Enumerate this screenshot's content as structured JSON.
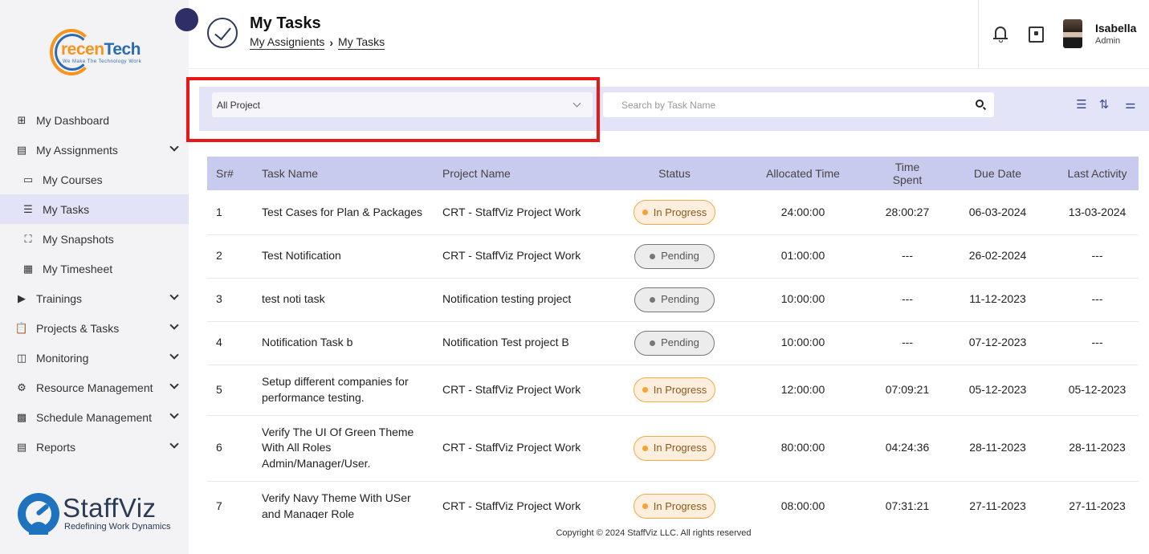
{
  "brand": {
    "name_part1": "recen",
    "name_part2": "Tech",
    "tagline": "We Make The Technology Work"
  },
  "sidebar": {
    "items": [
      {
        "label": "My Dashboard",
        "icon": "dashboard-icon"
      },
      {
        "label": "My Assignments",
        "icon": "assignments-icon"
      },
      {
        "label": "My Courses",
        "icon": "courses-icon"
      },
      {
        "label": "My Tasks",
        "icon": "tasks-icon"
      },
      {
        "label": "My Snapshots",
        "icon": "snapshots-icon"
      },
      {
        "label": "My Timesheet",
        "icon": "timesheet-icon"
      },
      {
        "label": "Trainings",
        "icon": "trainings-icon"
      },
      {
        "label": "Projects & Tasks",
        "icon": "projects-icon"
      },
      {
        "label": "Monitoring",
        "icon": "monitoring-icon"
      },
      {
        "label": "Resource Management",
        "icon": "resource-icon"
      },
      {
        "label": "Schedule Management",
        "icon": "schedule-icon"
      },
      {
        "label": "Reports",
        "icon": "reports-icon"
      }
    ]
  },
  "footer_brand": {
    "name": "StaffViz",
    "tagline": "Redefining Work Dynamics"
  },
  "header": {
    "title": "My Tasks",
    "breadcrumb": [
      "My Assignients",
      "My Tasks"
    ]
  },
  "user": {
    "name": "Isabella",
    "role": "Admin"
  },
  "filters": {
    "project_select": "All Project",
    "search_placeholder": "Search by Task Name"
  },
  "table": {
    "columns": [
      "Sr#",
      "Task Name",
      "Project Name",
      "Status",
      "Allocated Time",
      "Time Spent",
      "Due Date",
      "Last Activity"
    ],
    "rows": [
      {
        "sr": "1",
        "task": "Test Cases for Plan & Packages",
        "project": "CRT - StaffViz Project Work",
        "status": "In Progress",
        "allocated": "24:00:00",
        "spent": "28:00:27",
        "due": "06-03-2024",
        "last": "13-03-2024"
      },
      {
        "sr": "2",
        "task": "Test Notification",
        "project": "CRT - StaffViz Project Work",
        "status": "Pending",
        "allocated": "01:00:00",
        "spent": "---",
        "due": "26-02-2024",
        "last": "---"
      },
      {
        "sr": "3",
        "task": "test noti task",
        "project": "Notification testing project",
        "status": "Pending",
        "allocated": "10:00:00",
        "spent": "---",
        "due": "11-12-2023",
        "last": "---"
      },
      {
        "sr": "4",
        "task": "Notification Task b",
        "project": "Notification Test project B",
        "status": "Pending",
        "allocated": "10:00:00",
        "spent": "---",
        "due": "07-12-2023",
        "last": "---"
      },
      {
        "sr": "5",
        "task": "Setup different companies for performance testing.",
        "project": "CRT - StaffViz Project Work",
        "status": "In Progress",
        "allocated": "12:00:00",
        "spent": "07:09:21",
        "due": "05-12-2023",
        "last": "05-12-2023"
      },
      {
        "sr": "6",
        "task": "Verify The UI Of Green Theme With All Roles Admin/Manager/User.",
        "project": "CRT - StaffViz Project Work",
        "status": "In Progress",
        "allocated": "80:00:00",
        "spent": "04:24:36",
        "due": "28-11-2023",
        "last": "28-11-2023"
      },
      {
        "sr": "7",
        "task": "Verify Navy Theme With USer and Manager Role",
        "project": "CRT - StaffViz Project Work",
        "status": "In Progress",
        "allocated": "08:00:00",
        "spent": "07:31:21",
        "due": "27-11-2023",
        "last": "27-11-2023"
      }
    ]
  },
  "footer": {
    "copyright": "Copyright © 2024 StaffViz LLC. All rights reserved"
  },
  "colors": {
    "accent": "#2e2f66",
    "in_progress": "#f3ab47",
    "pending": "#777777",
    "highlight": "#e81818",
    "header_row": "#c9cbee"
  }
}
